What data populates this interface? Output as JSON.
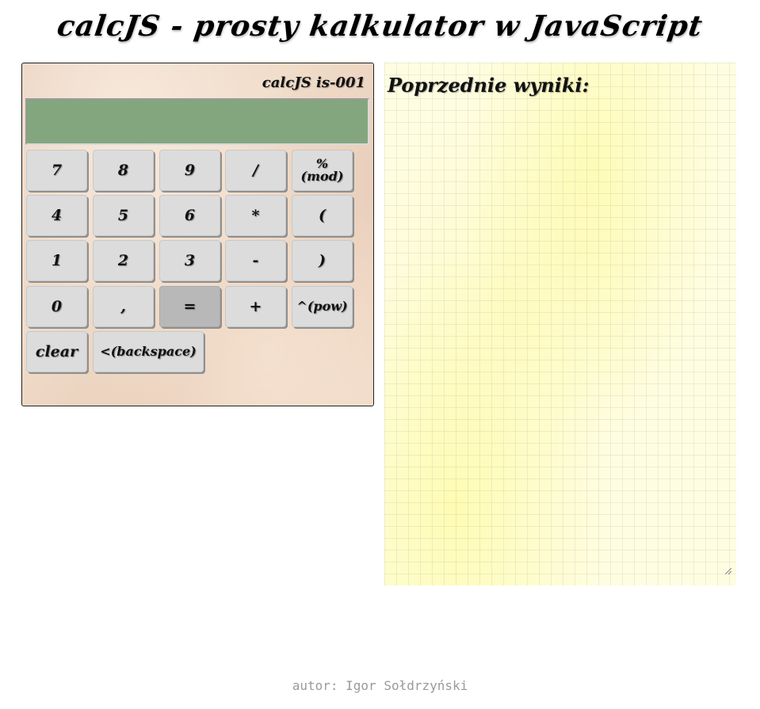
{
  "page": {
    "title": "calcJS - prosty kalkulator w JavaScript",
    "footer": "autor: Igor Sołdrzyński"
  },
  "calculator": {
    "model": "calcJS is-001",
    "display_value": "",
    "keys": {
      "k7": "7",
      "k8": "8",
      "k9": "9",
      "div": "/",
      "mod": "% (mod)",
      "k4": "4",
      "k5": "5",
      "k6": "6",
      "mul": "*",
      "lparen": "(",
      "k1": "1",
      "k2": "2",
      "k3": "3",
      "sub": "-",
      "rparen": ")",
      "k0": "0",
      "comma": ",",
      "eq": "=",
      "add": "+",
      "pow": "^(pow)",
      "clear": "clear",
      "backspace": "<(backspace)"
    }
  },
  "history": {
    "title": "Poprzednie wyniki:",
    "text": ""
  },
  "colors": {
    "display": "#83a67f",
    "key": "#dcdcdc",
    "key_pressed": "#b8b8b8",
    "notes_paper": "#fefde2"
  }
}
